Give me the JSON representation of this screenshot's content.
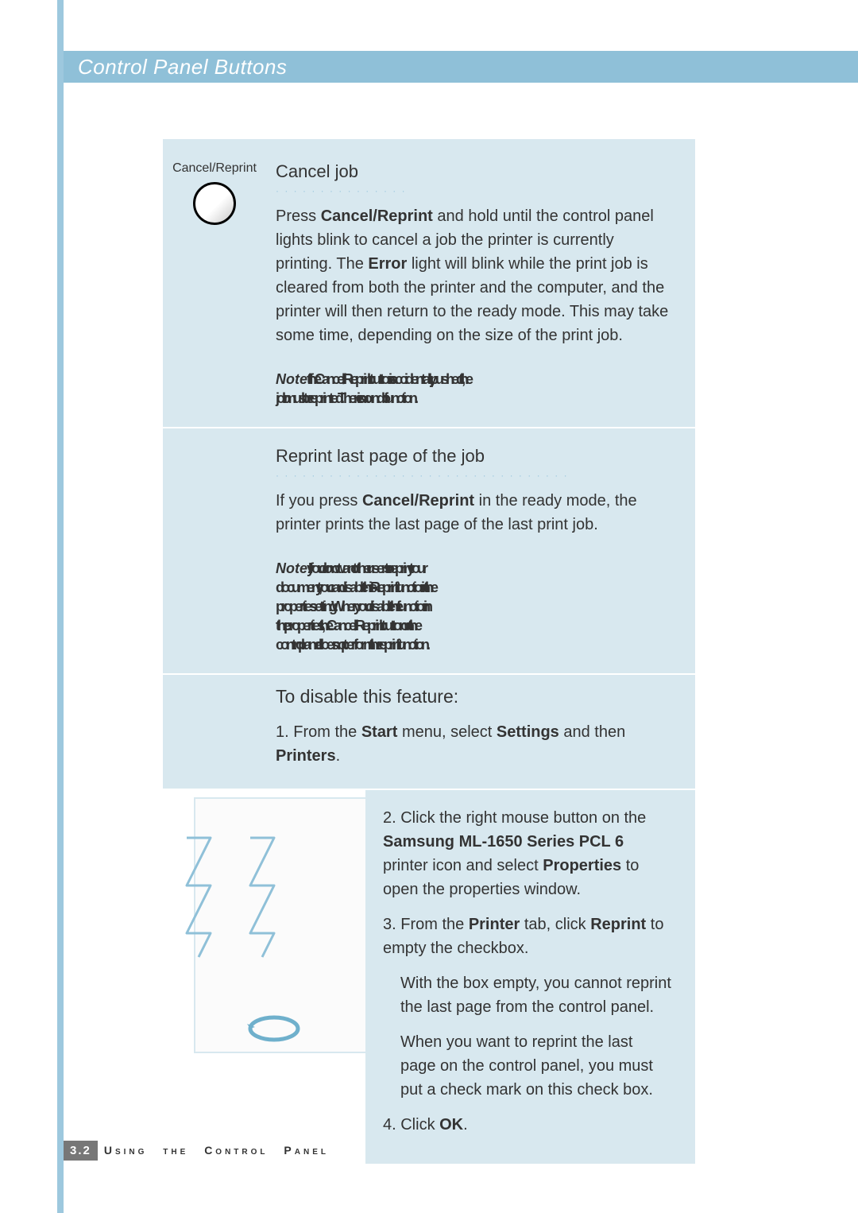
{
  "header": {
    "title": "Control Panel Buttons"
  },
  "sidebar": {
    "button_label": "Cancel/Reprint"
  },
  "cancel_job": {
    "title": "Cancel job",
    "p1_a": "Press ",
    "p1_b": "Cancel/Reprint",
    "p1_c": " and hold until the control panel lights blink to cancel a job the printer is currently printing. The ",
    "p1_d": "Error",
    "p1_e": " light will blink while the print job is cleared from both the printer and the computer, and the printer will then return to the ready mode. This may take some time, depending on the size of the print job.",
    "note_label": "Note:",
    "note_line1": " If the Cancel/Reprint button is accidentally pushed, the",
    "note_line2": "job must be reprinted. There is no undo function."
  },
  "reprint": {
    "title": "Reprint last page of the job",
    "p1_a": "If you press ",
    "p1_b": "Cancel/Reprint",
    "p1_c": " in the ready mode, the printer prints the last page of the last print job.",
    "note_label": "Note:",
    "note_l1": " If you do not want other users to reprint your",
    "note_l2": "document, you can disable this Reprint function in the",
    "note_l3": "properties setting. When you disable the function in",
    "note_l4": "the properties, the Cancel/Reprint button on the",
    "note_l5": "control panel does not perform the reprint function."
  },
  "disable": {
    "title": "To disable this feature:",
    "s1_a": "1. From the ",
    "s1_b": "Start",
    "s1_c": " menu, select ",
    "s1_d": "Settings",
    "s1_e": " and then ",
    "s1_f": "Printers",
    "s1_g": "."
  },
  "steps": {
    "s2_a": "2. Click the right mouse button on the ",
    "s2_b": "Samsung ML-1650 Series PCL 6",
    "s2_c": " printer icon and select ",
    "s2_d": "Properties",
    "s2_e": " to open the properties window.",
    "s3_a": "3. From the ",
    "s3_b": "Printer",
    "s3_c": " tab, click ",
    "s3_d": "Reprint",
    "s3_e": " to empty the checkbox.",
    "s3_f": "With the box empty, you cannot reprint the last page from the control panel.",
    "s3_g": "When you want to reprint the last page on the control panel, you must put a check mark on this check box.",
    "s4_a": "4. Click ",
    "s4_b": "OK",
    "s4_c": "."
  },
  "footer": {
    "badge": "3.2",
    "text": "Using the Control Panel"
  }
}
